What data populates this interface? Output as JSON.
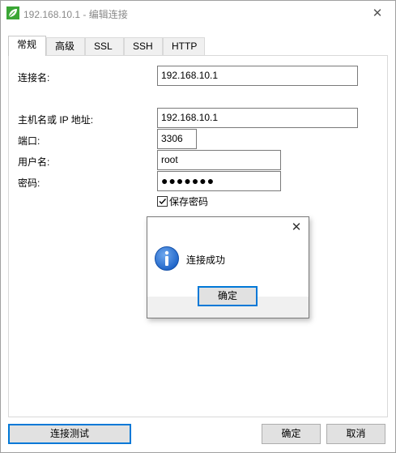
{
  "window": {
    "title": "192.168.10.1 - 编辑连接",
    "close_glyph": "✕"
  },
  "tabs": [
    {
      "label": "常规",
      "active": true
    },
    {
      "label": "高级",
      "active": false
    },
    {
      "label": "SSL",
      "active": false
    },
    {
      "label": "SSH",
      "active": false
    },
    {
      "label": "HTTP",
      "active": false
    }
  ],
  "form": {
    "connection_name_label": "连接名:",
    "connection_name_value": "192.168.10.1",
    "host_label": "主机名或 IP 地址:",
    "host_value": "192.168.10.1",
    "port_label": "端口:",
    "port_value": "3306",
    "user_label": "用户名:",
    "user_value": "root",
    "password_label": "密码:",
    "password_value": "●●●●●●●",
    "save_password_label": "保存密码",
    "save_password_checked": true
  },
  "message_box": {
    "close_glyph": "✕",
    "icon": "info-icon",
    "text": "连接成功",
    "ok_label": "确定"
  },
  "footer": {
    "test_label": "连接测试",
    "ok_label": "确定",
    "cancel_label": "取消"
  },
  "colors": {
    "accent": "#0078d7",
    "app_icon_green": "#3aa635",
    "info_icon_blue": "#1e64c8"
  }
}
